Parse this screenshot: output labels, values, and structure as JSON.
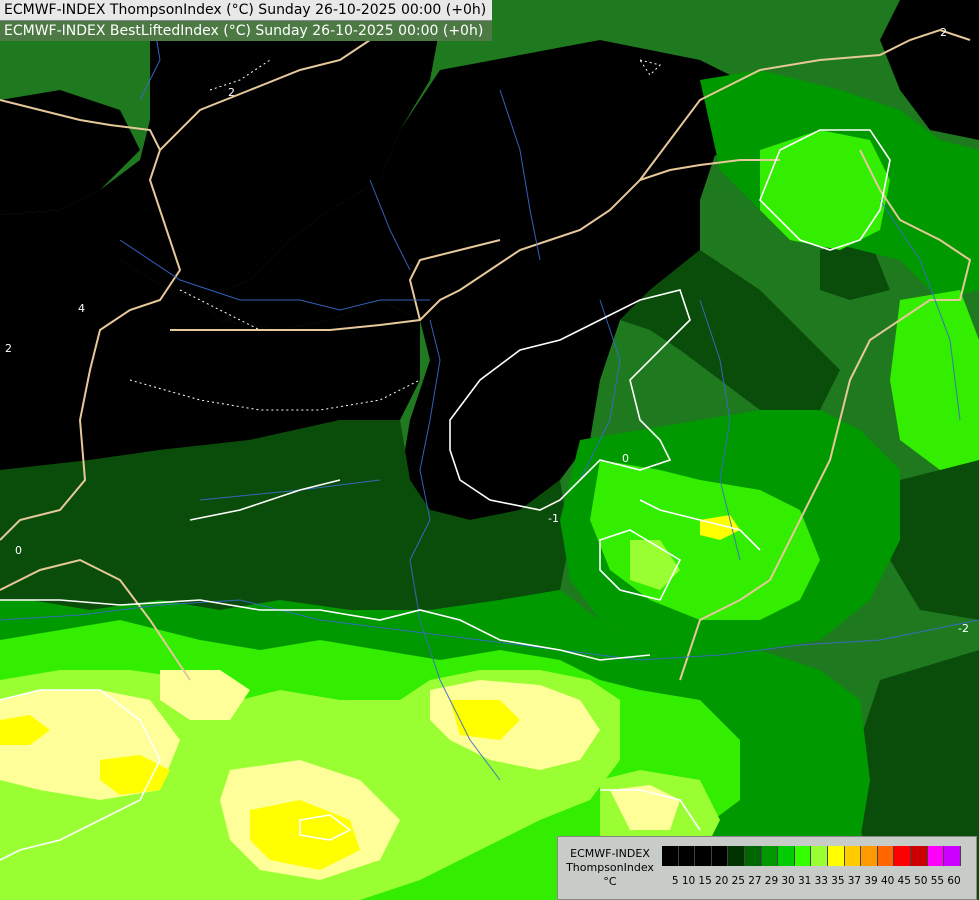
{
  "header": {
    "line1": "ECMWF-INDEX ThompsonIndex (°C) Sunday 26-10-2025 00:00 (+0h)",
    "line2": "ECMWF-INDEX BestLiftedIndex (°C) Sunday 26-10-2025 00:00 (+0h)"
  },
  "legend": {
    "title_line1": "ECMWF-INDEX",
    "title_line2": "ThompsonIndex",
    "unit": "°C",
    "ticks": [
      "5",
      "10",
      "15",
      "20",
      "25",
      "27",
      "29",
      "30",
      "31",
      "33",
      "35",
      "37",
      "39",
      "40",
      "45",
      "50",
      "55",
      "60"
    ],
    "colors": [
      "#000000",
      "#000000",
      "#000000",
      "#000000",
      "#003300",
      "#006600",
      "#009900",
      "#00cc00",
      "#33ff00",
      "#99ff33",
      "#ffff00",
      "#ffcc00",
      "#ff9900",
      "#ff6600",
      "#ff0000",
      "#cc0000",
      "#ff00ff",
      "#cc00ff",
      "#9900ff",
      "#6600ff",
      "#0000ff"
    ]
  },
  "contour_labels": [
    "2",
    "4",
    "2",
    "0",
    "-1",
    "-2",
    "0",
    "2"
  ],
  "layers": [
    "thompson-index-shading",
    "best-lifted-index-contours",
    "country-borders",
    "rivers"
  ]
}
